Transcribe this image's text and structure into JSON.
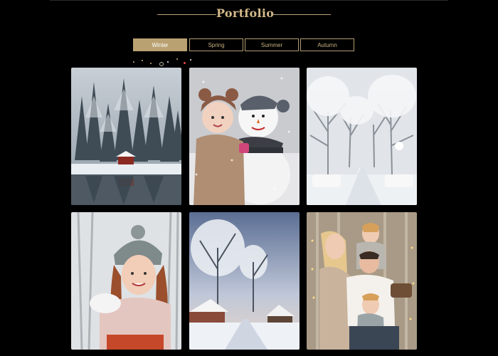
{
  "header": {
    "title": "Portfolio"
  },
  "tabs": [
    {
      "label": "Winter",
      "active": true
    },
    {
      "label": "Spring",
      "active": false
    },
    {
      "label": "Summer",
      "active": false
    },
    {
      "label": "Autumn",
      "active": false
    }
  ],
  "colors": {
    "background": "#000000",
    "accent_gold": "#d3b98a",
    "tab_active_bg": "#b9a171",
    "tab_border": "#b19d72"
  },
  "gallery": {
    "images": [
      {
        "subject": "snowy forest lake cabin"
      },
      {
        "subject": "girl with snowman"
      },
      {
        "subject": "snowy tree-lined road"
      },
      {
        "subject": "smiling woman in knit hat"
      },
      {
        "subject": "frosty trees and village road"
      },
      {
        "subject": "family with two boys"
      }
    ]
  }
}
